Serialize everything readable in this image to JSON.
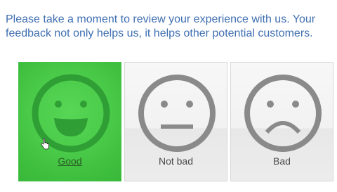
{
  "prompt": {
    "line1": "Please take a moment to review your experience with us. Your",
    "line2": "feedback not only helps us, it helps other potential customers."
  },
  "ratings": [
    {
      "label": "Good",
      "icon": "happy-face-icon",
      "selected": true
    },
    {
      "label": "Not bad",
      "icon": "neutral-face-icon",
      "selected": false
    },
    {
      "label": "Bad",
      "icon": "sad-face-icon",
      "selected": false
    }
  ],
  "colors": {
    "prompt_text": "#3f6fb1",
    "selected_bg": "#4ccd4b",
    "selected_face": "#2f9e35",
    "unselected_face": "#8a8a8a"
  }
}
